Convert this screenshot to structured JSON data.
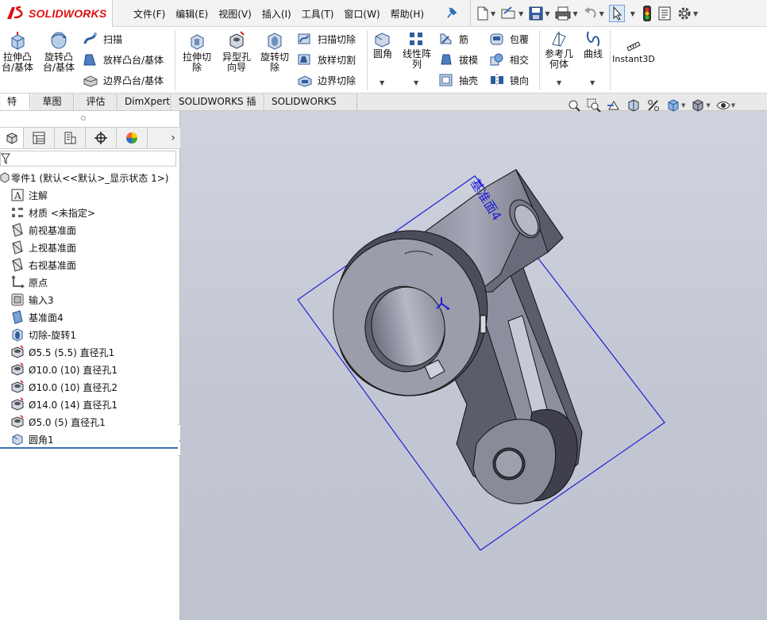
{
  "app": {
    "logo_text": "SOLIDWORKS"
  },
  "menu": [
    "文件(F)",
    "编辑(E)",
    "视图(V)",
    "插入(I)",
    "工具(T)",
    "窗口(W)",
    "帮助(H)"
  ],
  "toolbar": {
    "features": {
      "extrude_boss": "拉伸凸\n台/基体",
      "revolve_boss": "旋转凸\n台/基体",
      "sweep": "扫描",
      "loft_boss": "放样凸台/基体",
      "boundary_boss": "边界凸台/基体",
      "extrude_cut": "拉伸切\n除",
      "hole_wizard": "异型孔\n向导",
      "revolve_cut": "旋转切\n除",
      "swept_cut": "扫描切除",
      "lofted_cut": "放样切割",
      "boundary_cut": "边界切除",
      "fillet": "圆角",
      "linear_pattern": "线性阵\n列",
      "rib": "筋",
      "draft": "拔模",
      "shell": "抽壳",
      "wrap": "包覆",
      "intersect": "相交",
      "mirror": "镜向",
      "ref_geometry": "参考几\n何体",
      "curves": "曲线",
      "instant3d": "Instant3D"
    }
  },
  "tabs": [
    {
      "label": "特征",
      "active": true
    },
    {
      "label": "草图"
    },
    {
      "label": "评估"
    },
    {
      "label": "DimXpert"
    },
    {
      "label": "SOLIDWORKS 插件"
    },
    {
      "label": "SOLIDWORKS MBD"
    }
  ],
  "tree": {
    "root": "零件1 (默认<<默认>_显示状态 1>)",
    "items": [
      {
        "label": "注解",
        "icon": "annotation-icon"
      },
      {
        "label": "材质 <未指定>",
        "icon": "material-icon"
      },
      {
        "label": "前视基准面",
        "icon": "plane-icon"
      },
      {
        "label": "上视基准面",
        "icon": "plane-icon"
      },
      {
        "label": "右视基准面",
        "icon": "plane-icon"
      },
      {
        "label": "原点",
        "icon": "origin-icon"
      },
      {
        "label": "输入3",
        "icon": "imported-body-icon"
      },
      {
        "label": "基准面4",
        "icon": "plane-blue-icon"
      },
      {
        "label": "切除-旋转1",
        "icon": "revolve-cut-icon"
      },
      {
        "label": "Ø5.5 (5.5) 直径孔1",
        "icon": "hole-icon"
      },
      {
        "label": "Ø10.0 (10) 直径孔1",
        "icon": "hole-icon"
      },
      {
        "label": "Ø10.0 (10) 直径孔2",
        "icon": "hole-icon"
      },
      {
        "label": "Ø14.0 (14) 直径孔1",
        "icon": "hole-icon"
      },
      {
        "label": "Ø5.0 (5) 直径孔1",
        "icon": "hole-icon"
      },
      {
        "label": "圆角1",
        "icon": "fillet-icon"
      }
    ]
  },
  "viewport": {
    "plane_label": "基准面4"
  },
  "colors": {
    "accent": "#1a4fa0",
    "plane_blue": "#1f1fd6",
    "logo_red": "#d11111",
    "part_gray": "#9a9caa"
  }
}
